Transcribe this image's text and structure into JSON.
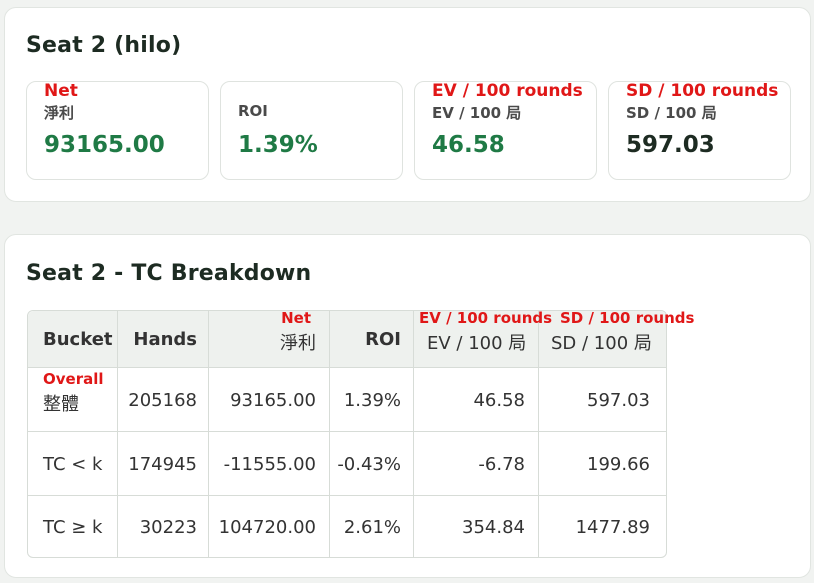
{
  "summary": {
    "title": "Seat 2 (hilo)",
    "stats": [
      {
        "en": "Net",
        "label": "淨利",
        "value": "93165.00",
        "color": "green"
      },
      {
        "en": "",
        "label": "ROI",
        "value": "1.39%",
        "color": "green"
      },
      {
        "en": "EV / 100 rounds",
        "label": "EV / 100 局",
        "value": "46.58",
        "color": "green"
      },
      {
        "en": "SD / 100 rounds",
        "label": "SD / 100 局",
        "value": "597.03",
        "color": "dark"
      }
    ]
  },
  "breakdown": {
    "title": "Seat 2 - TC Breakdown",
    "headers": {
      "bucket": "Bucket",
      "hands": "Hands",
      "net_en": "Net",
      "net": "淨利",
      "roi": "ROI",
      "ev_en": "EV / 100 rounds",
      "ev": "EV / 100 局",
      "sd_en": "SD / 100 rounds",
      "sd": "SD / 100 局"
    },
    "rows": [
      {
        "bucket_en": "Overall",
        "bucket": "整體",
        "hands": "205168",
        "net": "93165.00",
        "roi": "1.39%",
        "ev": "46.58",
        "sd": "597.03"
      },
      {
        "bucket_en": "",
        "bucket": "TC < k",
        "hands": "174945",
        "net": "-11555.00",
        "roi": "-0.43%",
        "ev": "-6.78",
        "sd": "199.66"
      },
      {
        "bucket_en": "",
        "bucket": "TC ≥ k",
        "hands": "30223",
        "net": "104720.00",
        "roi": "2.61%",
        "ev": "354.84",
        "sd": "1477.89"
      }
    ]
  },
  "colors": {
    "positive": "#1f7a45",
    "dark": "#1d2b22",
    "annotation": "#e01717"
  }
}
